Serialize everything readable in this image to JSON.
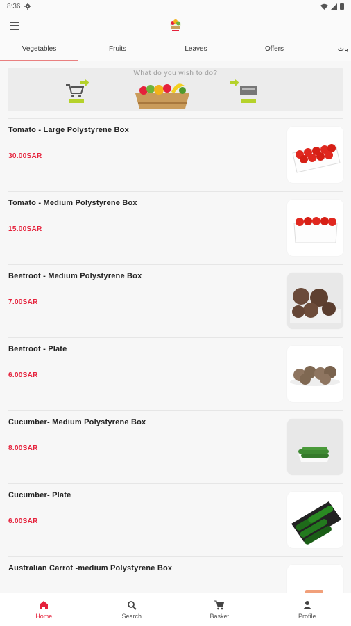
{
  "status_bar": {
    "time": "8:36",
    "icons": [
      "gear-icon",
      "wifi-icon",
      "signal-icon",
      "battery-icon"
    ]
  },
  "app_bar": {
    "menu_icon": "hamburger-icon",
    "logo": "app-logo"
  },
  "tabs": [
    {
      "label": "Vegetables",
      "active": true
    },
    {
      "label": "Fruits",
      "active": false
    },
    {
      "label": "Leaves",
      "active": false
    },
    {
      "label": "Offers",
      "active": false
    },
    {
      "label": "بات",
      "active": false
    }
  ],
  "banner": {
    "title": "What do you wish to do?"
  },
  "products": [
    {
      "name": "Tomato - Large Polystyrene Box",
      "price": "30.00SAR",
      "image": "tomato-box-large"
    },
    {
      "name": "Tomato - Medium Polystyrene Box",
      "price": "15.00SAR",
      "image": "tomato-box-medium"
    },
    {
      "name": "Beetroot -  Medium Polystyrene Box",
      "price": "7.00SAR",
      "image": "beetroot-box"
    },
    {
      "name": "Beetroot - Plate",
      "price": "6.00SAR",
      "image": "beetroot-plate"
    },
    {
      "name": "Cucumber- Medium Polystyrene Box",
      "price": "8.00SAR",
      "image": "cucumber-box"
    },
    {
      "name": "Cucumber- Plate",
      "price": "6.00SAR",
      "image": "cucumber-plate"
    },
    {
      "name": "Australian Carrot -medium Polystyrene Box",
      "price": "",
      "image": "carrot-box"
    }
  ],
  "bottom_nav": [
    {
      "label": "Home",
      "icon": "home-icon",
      "active": true
    },
    {
      "label": "Search",
      "icon": "search-icon",
      "active": false
    },
    {
      "label": "Basket",
      "icon": "cart-icon",
      "active": false
    },
    {
      "label": "Profile",
      "icon": "person-icon",
      "active": false
    }
  ],
  "colors": {
    "accent": "#e5213b",
    "tab_indicator": "#e98080",
    "background": "#f7f7f7"
  }
}
